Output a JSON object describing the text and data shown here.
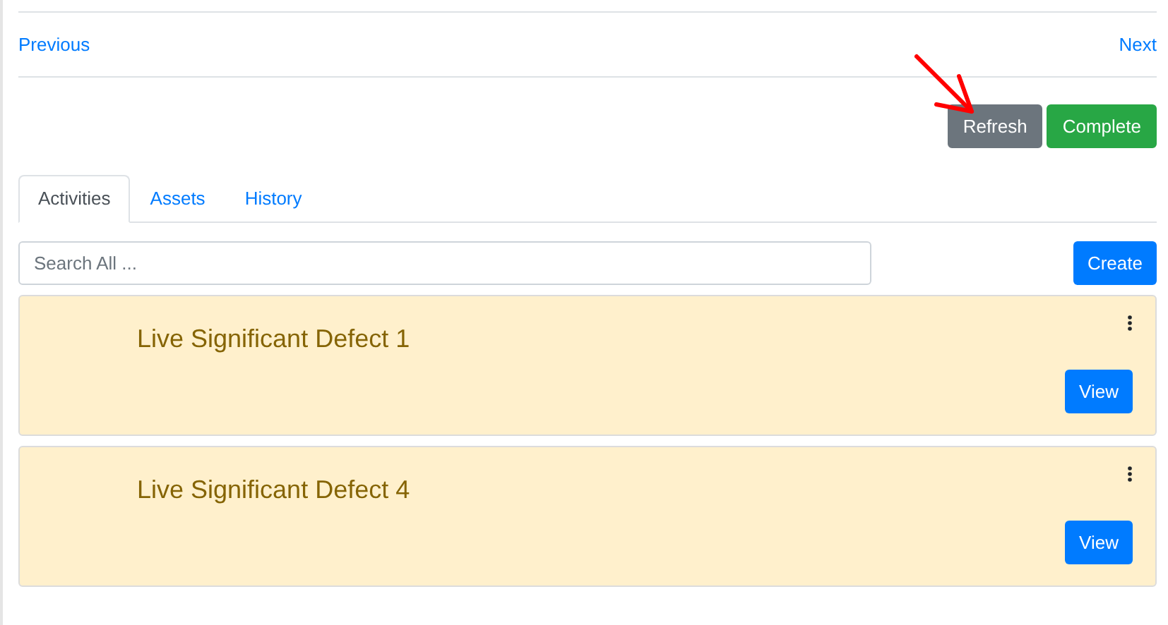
{
  "pager": {
    "previous": "Previous",
    "next": "Next"
  },
  "actions": [
    {
      "label": "Refresh",
      "kind": "secondary"
    },
    {
      "label": "Complete",
      "kind": "success"
    }
  ],
  "tabs": [
    {
      "label": "Activities",
      "selected": true
    },
    {
      "label": "Assets",
      "selected": false
    },
    {
      "label": "History",
      "selected": false
    }
  ],
  "search": {
    "placeholder": "Search All ..."
  },
  "create_button": "Create",
  "activities": [
    {
      "title": "Live Significant Defect 1",
      "button": "View"
    },
    {
      "title": "Live Significant Defect 4",
      "button": "View"
    }
  ]
}
